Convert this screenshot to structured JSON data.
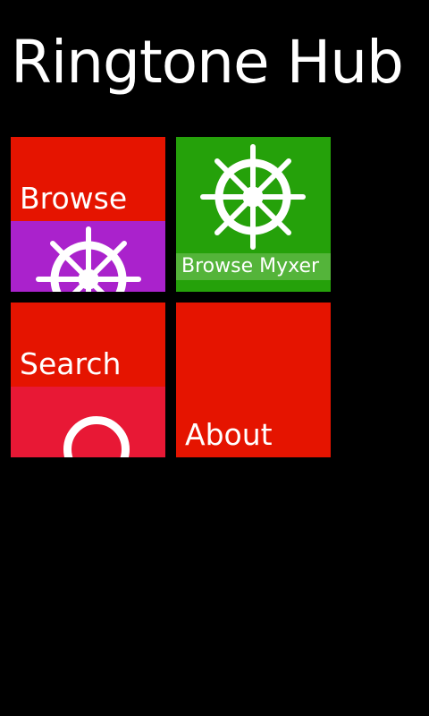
{
  "app": {
    "title": "Ringtone Hub"
  },
  "tiles": [
    {
      "label": "Browse",
      "color": "#e51400",
      "lower_color": "#aa22cc",
      "icon": "ship-wheel-icon"
    },
    {
      "label": "Browse Myxer",
      "color": "#25a10a",
      "icon": "ship-wheel-icon"
    },
    {
      "label": "Search",
      "color": "#e51400",
      "lower_color": "#e81835",
      "icon": "search-ring-icon"
    },
    {
      "label": "About",
      "color": "#e51400"
    }
  ],
  "colors": {
    "background": "#000000",
    "text": "#ffffff"
  }
}
